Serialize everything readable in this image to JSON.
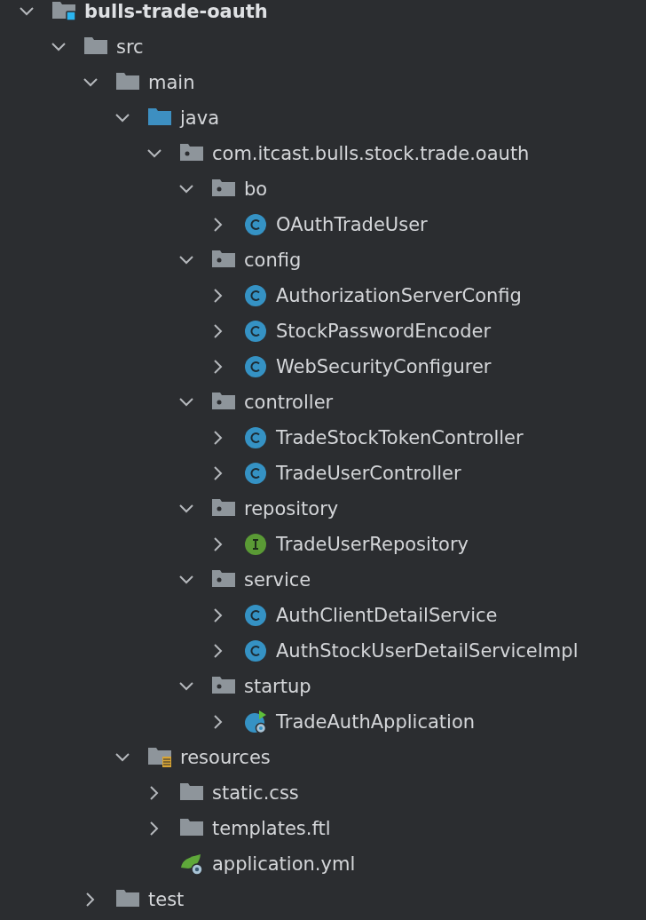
{
  "tree": {
    "label": "bulls-trade-oauth",
    "kind": "module",
    "expanded": true,
    "children": [
      {
        "label": "src",
        "kind": "folder",
        "expanded": true,
        "children": [
          {
            "label": "main",
            "kind": "folder",
            "expanded": true,
            "children": [
              {
                "label": "java",
                "kind": "source-folder",
                "expanded": true,
                "children": [
                  {
                    "label": "com.itcast.bulls.stock.trade.oauth",
                    "kind": "package",
                    "expanded": true,
                    "children": [
                      {
                        "label": "bo",
                        "kind": "package",
                        "expanded": true,
                        "children": [
                          {
                            "label": "OAuthTradeUser",
                            "kind": "class",
                            "expanded": false
                          }
                        ]
                      },
                      {
                        "label": "config",
                        "kind": "package",
                        "expanded": true,
                        "children": [
                          {
                            "label": "AuthorizationServerConfig",
                            "kind": "class",
                            "expanded": false
                          },
                          {
                            "label": "StockPasswordEncoder",
                            "kind": "class",
                            "expanded": false
                          },
                          {
                            "label": "WebSecurityConfigurer",
                            "kind": "class",
                            "expanded": false
                          }
                        ]
                      },
                      {
                        "label": "controller",
                        "kind": "package",
                        "expanded": true,
                        "children": [
                          {
                            "label": "TradeStockTokenController",
                            "kind": "class",
                            "expanded": false
                          },
                          {
                            "label": "TradeUserController",
                            "kind": "class",
                            "expanded": false
                          }
                        ]
                      },
                      {
                        "label": "repository",
                        "kind": "package",
                        "expanded": true,
                        "children": [
                          {
                            "label": "TradeUserRepository",
                            "kind": "interface",
                            "expanded": false
                          }
                        ]
                      },
                      {
                        "label": "service",
                        "kind": "package",
                        "expanded": true,
                        "children": [
                          {
                            "label": "AuthClientDetailService",
                            "kind": "class",
                            "expanded": false
                          },
                          {
                            "label": "AuthStockUserDetailServiceImpl",
                            "kind": "class",
                            "expanded": false
                          }
                        ]
                      },
                      {
                        "label": "startup",
                        "kind": "package",
                        "expanded": true,
                        "children": [
                          {
                            "label": "TradeAuthApplication",
                            "kind": "spring-app",
                            "expanded": false
                          }
                        ]
                      }
                    ]
                  }
                ]
              },
              {
                "label": "resources",
                "kind": "resource-folder",
                "expanded": true,
                "children": [
                  {
                    "label": "static.css",
                    "kind": "folder",
                    "expanded": false
                  },
                  {
                    "label": "templates.ftl",
                    "kind": "folder",
                    "expanded": false
                  },
                  {
                    "label": "application.yml",
                    "kind": "yaml"
                  }
                ]
              }
            ]
          },
          {
            "label": "test",
            "kind": "folder",
            "expanded": false
          }
        ]
      }
    ]
  }
}
